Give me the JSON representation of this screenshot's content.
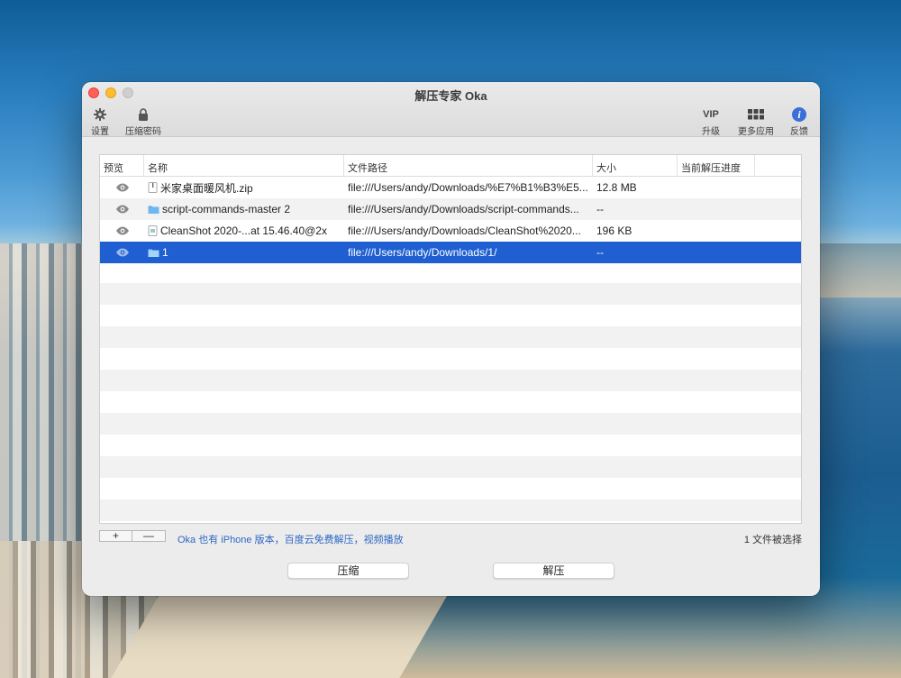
{
  "window": {
    "title": "解压专家 Oka"
  },
  "toolbar": {
    "settings_label": "设置",
    "password_label": "压缩密码",
    "upgrade_top": "VIP",
    "upgrade_label": "升级",
    "more_apps_label": "更多应用",
    "feedback_label": "反馈"
  },
  "table": {
    "headers": [
      "预览",
      "名称",
      "文件路径",
      "大小",
      "当前解压进度",
      ""
    ],
    "rows": [
      {
        "name": "米家桌面暖风机.zip",
        "icon": "zip-file-icon",
        "path": "file:///Users/andy/Downloads/%E7%B1%B3%E5...",
        "size": "12.8 MB",
        "progress": ""
      },
      {
        "name": "script-commands-master 2",
        "icon": "folder-icon",
        "path": "file:///Users/andy/Downloads/script-commands...",
        "size": "--",
        "progress": ""
      },
      {
        "name": "CleanShot 2020-...at 15.46.40@2x",
        "icon": "image-file-icon",
        "path": "file:///Users/andy/Downloads/CleanShot%2020...",
        "size": "196 KB",
        "progress": ""
      },
      {
        "name": "1",
        "icon": "folder-icon",
        "path": "file:///Users/andy/Downloads/1/",
        "size": "--",
        "progress": ""
      }
    ],
    "selected_row": 3
  },
  "footer": {
    "add_label": "+",
    "remove_label": "—",
    "promo_text": "Oka 也有 iPhone 版本，百度云免费解压，视频播放",
    "selection_status": "1 文件被选择",
    "compress_label": "压缩",
    "extract_label": "解压"
  },
  "colors": {
    "selection": "#1f5fd1",
    "promo_link": "#2d67c4",
    "close": "#ff5f57",
    "minimize": "#febc2e"
  }
}
